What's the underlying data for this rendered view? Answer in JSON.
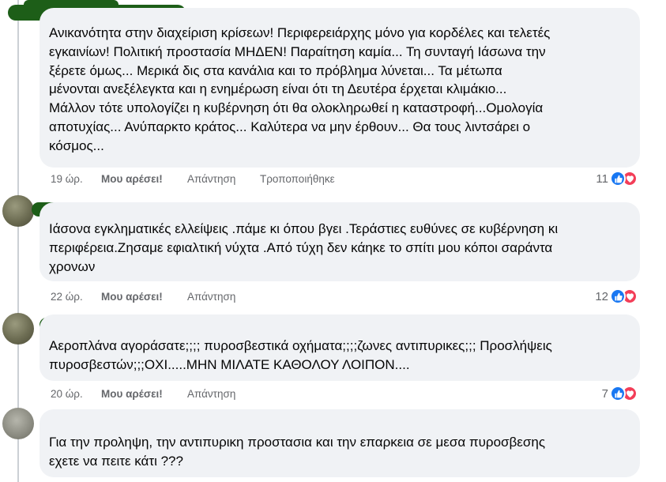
{
  "comments": [
    {
      "text": "Ανικανότητα στην διαχείριση κρίσεων! Περιφερειάρχης μόνο για κορδέλες και τελετές\nεγκαινίων! Πολιτική προστασία ΜΗΔΕΝ! Παραίτηση καμία... Τη συνταγή Ιάσωνα την\nξέρετε όμως... Μερικά δις στα κανάλια και το πρόβλημα λύνεται... Τα μέτωπα\nμένονται ανεξέλεγκτα και η ενημέρωση είναι ότι τη Δευτέρα έρχεται κλιμάκιο...\nΜάλλον τότε υπολογίζει η κυβέρνηση ότι θα ολοκληρωθεί η καταστροφή...Ομολογία\nαποτυχίας... Ανύπαρκτο κράτος... Καλύτερα να μην έρθουν... Θα τους λιντσάρει ο\nκόσμος...",
      "time": "19 ώρ.",
      "like_label": "Μου αρέσει!",
      "reply_label": "Απάντηση",
      "edited_label": "Τροποποιήθηκε",
      "reaction_count": "11",
      "reactions": [
        "like-icon",
        "love-icon"
      ]
    },
    {
      "text": "Ιάσονα εγκληματικές ελλείψεις .πάμε κι όπου βγει .Τεράστιες ευθύνες σε κυβέρνηση κι\nπεριφέρεια.Ζησαμε εφιαλτική νύχτα .Από τύχη δεν κάηκε το σπίτι μου κόποι σαράντα\nχρονων",
      "time": "22 ώρ.",
      "like_label": "Μου αρέσει!",
      "reply_label": "Απάντηση",
      "reaction_count": "12",
      "reactions": [
        "like-icon",
        "love-icon"
      ]
    },
    {
      "text": "Αεροπλάνα αγοράσατε;;;; πυροσβεστικά οχήματα;;;;ζωνες αντιπυρικες;;; Προσλήψεις\nπυροσβεστών;;;ΟΧΙ.....ΜΗΝ ΜΙΛΑΤΕ ΚΑΘΟΛΟΥ ΛΟΙΠΟΝ....",
      "time": "20 ώρ.",
      "like_label": "Μου αρέσει!",
      "reply_label": "Απάντηση",
      "reaction_count": "7",
      "reactions": [
        "like-icon",
        "love-icon"
      ]
    },
    {
      "text": "Για την προληψη, την αντιπυρικη προστασια και την επαρκεια σε μεσα πυροσβεσης\nεχετε να πειτε κάτι ???"
    }
  ],
  "colors": {
    "bubble": "#f0f2f5",
    "meta_text": "#65676b",
    "like_blue": "#1877f2",
    "love_red": "#f33e58",
    "redaction_green": "#1d5e18"
  }
}
